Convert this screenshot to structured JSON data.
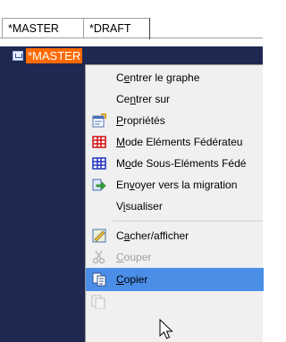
{
  "tabs": [
    {
      "label": "*MASTER"
    },
    {
      "label": "*DRAFT"
    }
  ],
  "tree": {
    "selected_label": "*MASTER"
  },
  "menu": {
    "items": [
      {
        "pre": "C",
        "ul": "e",
        "post": "ntrer le graphe",
        "icon": "",
        "disabled": false
      },
      {
        "pre": "Ce",
        "ul": "n",
        "post": "trer sur",
        "icon": "",
        "disabled": false
      },
      {
        "pre": "",
        "ul": "P",
        "post": "ropriétés",
        "icon": "properties-icon",
        "disabled": false
      },
      {
        "pre": "",
        "ul": "M",
        "post": "ode Eléments Fédérateu",
        "icon": "red-grid-icon",
        "disabled": false
      },
      {
        "pre": "M",
        "ul": "o",
        "post": "de Sous-Eléments Fédé",
        "icon": "blue-grid-icon",
        "disabled": false
      },
      {
        "pre": "En",
        "ul": "v",
        "post": "oyer vers la migration",
        "icon": "send-arrow-icon",
        "disabled": false
      },
      {
        "pre": "V",
        "ul": "i",
        "post": "sualiser",
        "icon": "",
        "disabled": false
      },
      {
        "pre": "C",
        "ul": "a",
        "post": "cher/afficher",
        "icon": "hide-show-icon",
        "disabled": false
      },
      {
        "pre": "",
        "ul": "C",
        "post": "ouper",
        "icon": "scissors-icon",
        "disabled": true
      },
      {
        "pre": "",
        "ul": "C",
        "post": "opier",
        "icon": "copy-icon",
        "disabled": false
      }
    ]
  }
}
